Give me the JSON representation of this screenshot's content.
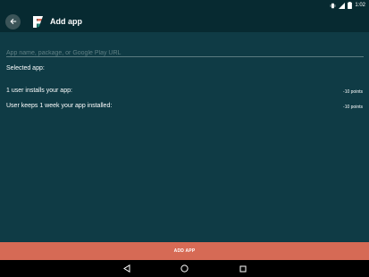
{
  "status_bar": {
    "time": "1:02",
    "icons": [
      "vibrate-icon",
      "signal-icon",
      "battery-icon"
    ]
  },
  "toolbar": {
    "title": "Add app",
    "back_icon": "arrow-back-icon",
    "logo_icon": "app-logo-icon"
  },
  "search": {
    "placeholder": "App name, package, or Google Play URL",
    "value": ""
  },
  "selected_app": {
    "label": "Selected app:"
  },
  "rules": [
    {
      "label": "1 user installs your app:",
      "points": "-10 points"
    },
    {
      "label": "User keeps 1 week your app installed:",
      "points": "-10 points"
    }
  ],
  "add_button": {
    "label": "ADD APP"
  },
  "nav_bar": {
    "icons": [
      "back-triangle-icon",
      "home-circle-icon",
      "recents-square-icon"
    ]
  },
  "colors": {
    "background": "#0f3b45",
    "toolbar": "#072a31",
    "accent": "#d66a55",
    "nav_bar": "#000000"
  }
}
